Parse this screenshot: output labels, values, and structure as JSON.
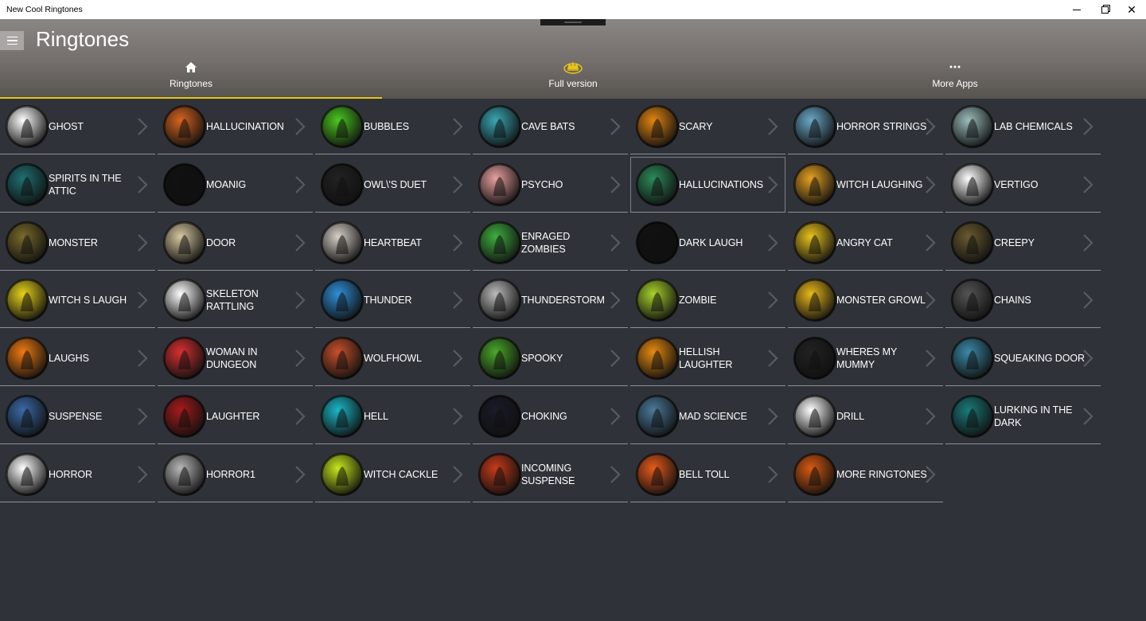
{
  "window": {
    "title": "New Cool Ringtones"
  },
  "header": {
    "title": "Ringtones"
  },
  "tabs": [
    {
      "label": "Ringtones",
      "icon": "home-icon",
      "active": true
    },
    {
      "label": "Full version",
      "icon": "crown-icon",
      "active": false
    },
    {
      "label": "More Apps",
      "icon": "more-icon",
      "active": false
    }
  ],
  "colors": {
    "accent": "#e6c417",
    "background": "#2f3238"
  },
  "tiles": [
    {
      "label": "GHOST",
      "icon": "ghost-icon",
      "color": "#ffffff"
    },
    {
      "label": "HALLUCINATION",
      "icon": "mushroom-icon",
      "color": "#d8641e"
    },
    {
      "label": "BUBBLES",
      "icon": "cauldron-icon",
      "color": "#4bc81e"
    },
    {
      "label": "CAVE BATS",
      "icon": "bats-icon",
      "color": "#39a7b3"
    },
    {
      "label": "SCARY",
      "icon": "haunted-house-icon",
      "color": "#e38410"
    },
    {
      "label": "HORROR STRINGS",
      "icon": "tree-icon",
      "color": "#6aa8c9"
    },
    {
      "label": "LAB CHEMICALS",
      "icon": "flask-icon",
      "color": "#9bbcbc"
    },
    {
      "label": "SPIRITS IN THE ATTIC",
      "icon": "spirit-icon",
      "color": "#1f6f73"
    },
    {
      "label": "MOANIG",
      "icon": "ghost-icon",
      "color": "#111111"
    },
    {
      "label": "OWL\\'S DUET",
      "icon": "owl-icon",
      "color": "#222222"
    },
    {
      "label": "PSYCHO",
      "icon": "knife-icon",
      "color": "#e9a0a0"
    },
    {
      "label": "HALLUCINATIONS",
      "icon": "face-icon",
      "color": "#2c8a5a"
    },
    {
      "label": "WITCH LAUGHING",
      "icon": "witch-icon",
      "color": "#e5a021"
    },
    {
      "label": "VERTIGO",
      "icon": "spiral-icon",
      "color": "#ffffff"
    },
    {
      "label": "MONSTER",
      "icon": "monster-icon",
      "color": "#7a6a2a"
    },
    {
      "label": "DOOR",
      "icon": "door-icon",
      "color": "#d8c8a0"
    },
    {
      "label": "HEARTBEAT",
      "icon": "heart-icon",
      "color": "#d8d0c8"
    },
    {
      "label": "ENRAGED ZOMBIES",
      "icon": "zombie-icon",
      "color": "#3fae3f"
    },
    {
      "label": "DARK LAUGH",
      "icon": "skull-icon",
      "color": "#111111"
    },
    {
      "label": "ANGRY CAT",
      "icon": "cat-icon",
      "color": "#e8c21a"
    },
    {
      "label": "CREEPY",
      "icon": "tree-icon",
      "color": "#6a5a30"
    },
    {
      "label": "WITCH S LAUGH",
      "icon": "witch-icon",
      "color": "#e8d21a"
    },
    {
      "label": "SKELETON RATTLING",
      "icon": "skeleton-icon",
      "color": "#ffffff"
    },
    {
      "label": "THUNDER",
      "icon": "lightning-icon",
      "color": "#2f8fd8"
    },
    {
      "label": "THUNDERSTORM",
      "icon": "storm-icon",
      "color": "#bbbbbb"
    },
    {
      "label": "ZOMBIE",
      "icon": "zombie-icon",
      "color": "#a8d22a"
    },
    {
      "label": "MONSTER GROWL",
      "icon": "monster-icon",
      "color": "#e8b81a"
    },
    {
      "label": "CHAINS",
      "icon": "chains-icon",
      "color": "#555555"
    },
    {
      "label": "LAUGHS",
      "icon": "pumpkin-icon",
      "color": "#f07a10"
    },
    {
      "label": "WOMAN IN DUNGEON",
      "icon": "mouth-icon",
      "color": "#d83030"
    },
    {
      "label": "WOLFHOWL",
      "icon": "wolf-icon",
      "color": "#c8502a"
    },
    {
      "label": "SPOOKY",
      "icon": "graveyard-icon",
      "color": "#4aa82a"
    },
    {
      "label": "HELLISH LAUGHTER",
      "icon": "pumpkin-icon",
      "color": "#e88a10"
    },
    {
      "label": "WHERES MY MUMMY",
      "icon": "mummy-icon",
      "color": "#222222"
    },
    {
      "label": "SQUEAKING DOOR",
      "icon": "door-icon",
      "color": "#3a8aa8"
    },
    {
      "label": "SUSPENSE",
      "icon": "graveyard-icon",
      "color": "#3a6aa8"
    },
    {
      "label": "LAUGHTER",
      "icon": "mouth-icon",
      "color": "#a81a1a"
    },
    {
      "label": "HELL",
      "icon": "fire-icon",
      "color": "#1ab8c8"
    },
    {
      "label": "CHOKING",
      "icon": "hand-icon",
      "color": "#1a1a2a"
    },
    {
      "label": "MAD SCIENCE",
      "icon": "scientist-icon",
      "color": "#4a7a9a"
    },
    {
      "label": "DRILL",
      "icon": "drill-icon",
      "color": "#ffffff"
    },
    {
      "label": "LURKING IN THE DARK",
      "icon": "figure-icon",
      "color": "#1a7a7a"
    },
    {
      "label": "HORROR",
      "icon": "scream-icon",
      "color": "#ffffff"
    },
    {
      "label": "HORROR1",
      "icon": "face-icon",
      "color": "#b8b8b8"
    },
    {
      "label": "WITCH CACKLE",
      "icon": "witch-hat-icon",
      "color": "#c8e81a"
    },
    {
      "label": "INCOMING SUSPENSE",
      "icon": "spider-icon",
      "color": "#c83a1a"
    },
    {
      "label": "BELL TOLL",
      "icon": "castle-icon",
      "color": "#e85a1a"
    },
    {
      "label": "MORE RINGTONES",
      "icon": "pumpkin-icon",
      "color": "#d85a10"
    }
  ]
}
